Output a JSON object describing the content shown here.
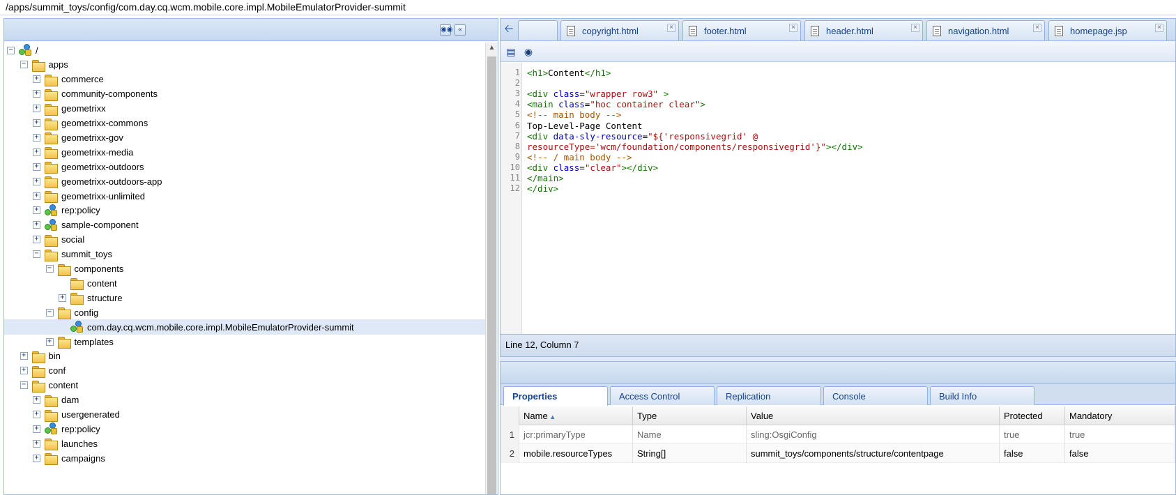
{
  "path": "/apps/summit_toys/config/com.day.cq.wcm.mobile.core.impl.MobileEmulatorProvider-summit",
  "tree": [
    {
      "label": "/",
      "depth": 0,
      "expander": "minus",
      "icon": "node",
      "name": "tree-node-root"
    },
    {
      "label": "apps",
      "depth": 1,
      "expander": "minus",
      "icon": "folder",
      "name": "tree-node-apps"
    },
    {
      "label": "commerce",
      "depth": 2,
      "expander": "plus",
      "icon": "folder",
      "name": "tree-node-commerce"
    },
    {
      "label": "community-components",
      "depth": 2,
      "expander": "plus",
      "icon": "folder",
      "name": "tree-node-community-components"
    },
    {
      "label": "geometrixx",
      "depth": 2,
      "expander": "plus",
      "icon": "folder",
      "name": "tree-node-geometrixx"
    },
    {
      "label": "geometrixx-commons",
      "depth": 2,
      "expander": "plus",
      "icon": "folder",
      "name": "tree-node-geometrixx-commons"
    },
    {
      "label": "geometrixx-gov",
      "depth": 2,
      "expander": "plus",
      "icon": "folder",
      "name": "tree-node-geometrixx-gov"
    },
    {
      "label": "geometrixx-media",
      "depth": 2,
      "expander": "plus",
      "icon": "folder",
      "name": "tree-node-geometrixx-media"
    },
    {
      "label": "geometrixx-outdoors",
      "depth": 2,
      "expander": "plus",
      "icon": "folder",
      "name": "tree-node-geometrixx-outdoors"
    },
    {
      "label": "geometrixx-outdoors-app",
      "depth": 2,
      "expander": "plus",
      "icon": "folder",
      "name": "tree-node-geometrixx-outdoors-app"
    },
    {
      "label": "geometrixx-unlimited",
      "depth": 2,
      "expander": "plus",
      "icon": "folder",
      "name": "tree-node-geometrixx-unlimited"
    },
    {
      "label": "rep:policy",
      "depth": 2,
      "expander": "plus",
      "icon": "node",
      "name": "tree-node-rep-policy"
    },
    {
      "label": "sample-component",
      "depth": 2,
      "expander": "plus",
      "icon": "node",
      "name": "tree-node-sample-component"
    },
    {
      "label": "social",
      "depth": 2,
      "expander": "plus",
      "icon": "folder",
      "name": "tree-node-social"
    },
    {
      "label": "summit_toys",
      "depth": 2,
      "expander": "minus",
      "icon": "folder",
      "name": "tree-node-summit-toys"
    },
    {
      "label": "components",
      "depth": 3,
      "expander": "minus",
      "icon": "folder",
      "name": "tree-node-components"
    },
    {
      "label": "content",
      "depth": 4,
      "expander": "none",
      "icon": "folder",
      "name": "tree-node-components-content"
    },
    {
      "label": "structure",
      "depth": 4,
      "expander": "plus",
      "icon": "folder",
      "name": "tree-node-structure"
    },
    {
      "label": "config",
      "depth": 3,
      "expander": "minus",
      "icon": "folder",
      "name": "tree-node-config"
    },
    {
      "label": "com.day.cq.wcm.mobile.core.impl.MobileEmulatorProvider-summit",
      "depth": 4,
      "expander": "none",
      "icon": "node",
      "selected": true,
      "name": "tree-node-mobile-emulator-provider"
    },
    {
      "label": "templates",
      "depth": 3,
      "expander": "plus",
      "icon": "folder",
      "name": "tree-node-templates"
    },
    {
      "label": "bin",
      "depth": 1,
      "expander": "plus",
      "icon": "folder",
      "name": "tree-node-bin"
    },
    {
      "label": "conf",
      "depth": 1,
      "expander": "plus",
      "icon": "folder",
      "name": "tree-node-conf"
    },
    {
      "label": "content",
      "depth": 1,
      "expander": "minus",
      "icon": "folder",
      "name": "tree-node-content"
    },
    {
      "label": "dam",
      "depth": 2,
      "expander": "plus",
      "icon": "folder",
      "name": "tree-node-dam"
    },
    {
      "label": "usergenerated",
      "depth": 2,
      "expander": "plus",
      "icon": "folder",
      "name": "tree-node-usergenerated"
    },
    {
      "label": "rep:policy",
      "depth": 2,
      "expander": "plus",
      "icon": "node",
      "name": "tree-node-content-rep-policy"
    },
    {
      "label": "launches",
      "depth": 2,
      "expander": "plus",
      "icon": "folder",
      "name": "tree-node-launches"
    },
    {
      "label": "campaigns",
      "depth": 2,
      "expander": "plus",
      "icon": "folder",
      "name": "tree-node-campaigns"
    }
  ],
  "tabs": [
    {
      "label": "copyright.html",
      "name": "tab-copyright-html"
    },
    {
      "label": "footer.html",
      "name": "tab-footer-html"
    },
    {
      "label": "header.html",
      "name": "tab-header-html"
    },
    {
      "label": "navigation.html",
      "name": "tab-navigation-html"
    },
    {
      "label": "homepage.jsp",
      "name": "tab-homepage-jsp"
    }
  ],
  "code_lines": [
    [
      {
        "t": "<h1>",
        "c": "tag"
      },
      {
        "t": "Content",
        "c": "plain"
      },
      {
        "t": "</h1>",
        "c": "tag"
      }
    ],
    [],
    [
      {
        "t": "<div ",
        "c": "tag"
      },
      {
        "t": "class",
        "c": "attr"
      },
      {
        "t": "=",
        "c": "plain"
      },
      {
        "t": "\"wrapper row3\"",
        "c": "str"
      },
      {
        "t": " >",
        "c": "tag"
      }
    ],
    [
      {
        "t": "<main ",
        "c": "tag"
      },
      {
        "t": "class",
        "c": "attr"
      },
      {
        "t": "=",
        "c": "plain"
      },
      {
        "t": "\"hoc container clear\"",
        "c": "str"
      },
      {
        "t": ">",
        "c": "tag"
      }
    ],
    [
      {
        "t": "<!-- main body -->",
        "c": "comment"
      }
    ],
    [
      {
        "t": "Top-Level-Page Content",
        "c": "plain"
      }
    ],
    [
      {
        "t": "<div ",
        "c": "tag"
      },
      {
        "t": "data-sly-resource",
        "c": "attr"
      },
      {
        "t": "=",
        "c": "plain"
      },
      {
        "t": "\"${'responsivegrid' @",
        "c": "str"
      }
    ],
    [
      {
        "t": "resourceType='wcm/foundation/components/responsivegrid'}\"",
        "c": "str"
      },
      {
        "t": "></div>",
        "c": "tag"
      }
    ],
    [
      {
        "t": "<!-- / main body -->",
        "c": "comment"
      }
    ],
    [
      {
        "t": "<div ",
        "c": "tag"
      },
      {
        "t": "class",
        "c": "attr"
      },
      {
        "t": "=",
        "c": "plain"
      },
      {
        "t": "\"clear\"",
        "c": "str"
      },
      {
        "t": "></div>",
        "c": "tag"
      }
    ],
    [
      {
        "t": "</main>",
        "c": "tag"
      }
    ],
    [
      {
        "t": "</div>",
        "c": "tag"
      }
    ]
  ],
  "status": "Line 12, Column 7",
  "prop_tabs": [
    {
      "label": "Properties",
      "active": true,
      "name": "tab-properties"
    },
    {
      "label": "Access Control",
      "name": "tab-access-control"
    },
    {
      "label": "Replication",
      "name": "tab-replication"
    },
    {
      "label": "Console",
      "name": "tab-console"
    },
    {
      "label": "Build Info",
      "name": "tab-build-info"
    }
  ],
  "columns": [
    "Name",
    "Type",
    "Value",
    "Protected",
    "Mandatory"
  ],
  "rows": [
    {
      "num": "1",
      "name": "jcr:primaryType",
      "type": "Name",
      "value": "sling:OsgiConfig",
      "protected": "true",
      "mandatory": "true",
      "dim": true
    },
    {
      "num": "2",
      "name": "mobile.resourceTypes",
      "type": "String[]",
      "value": "summit_toys/components/structure/contentpage",
      "protected": "false",
      "mandatory": "false",
      "dim": false
    }
  ],
  "icons": {
    "collapse": "double-chevron-left",
    "find": "binoculars",
    "back": "left-arrow",
    "tab_close": "x",
    "sort": "triangle-up"
  }
}
